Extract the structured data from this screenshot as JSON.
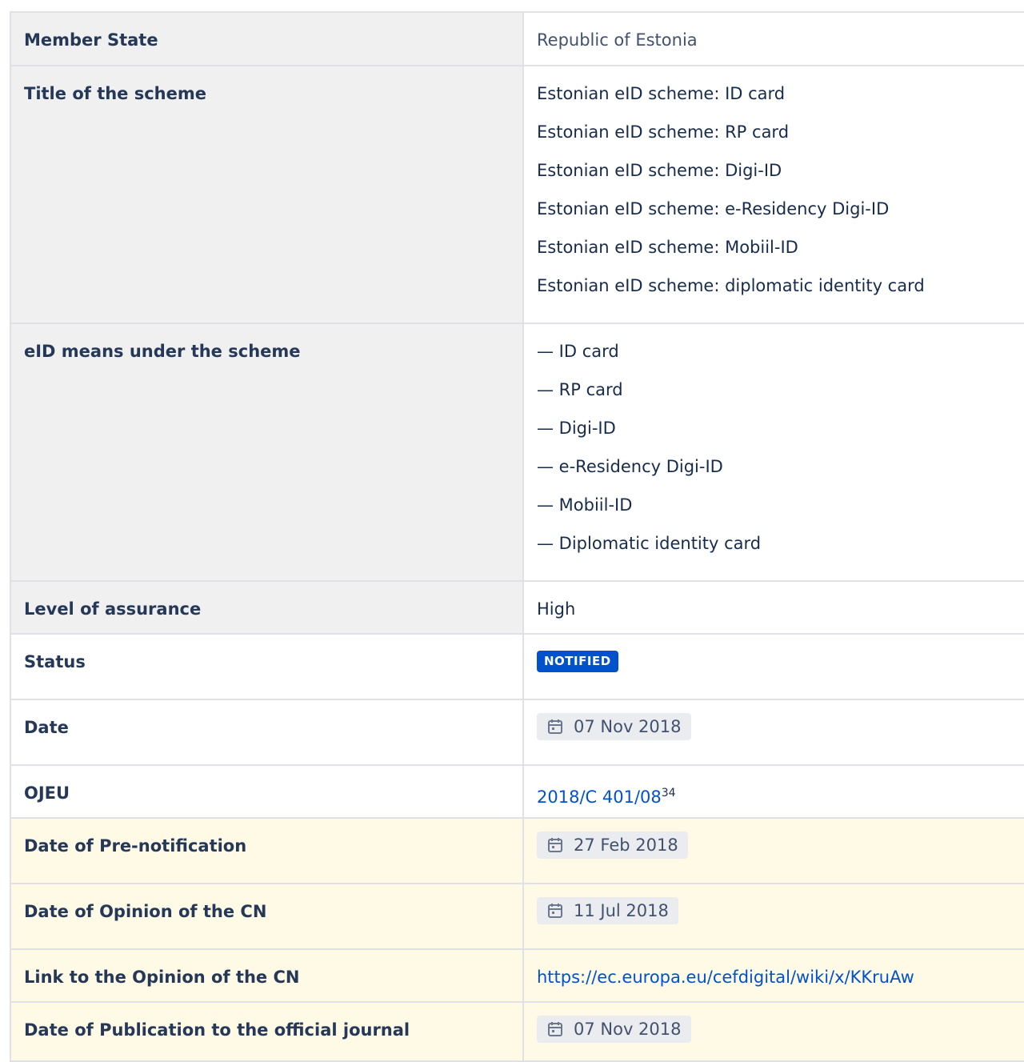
{
  "rows": {
    "member_state": {
      "label": "Member State",
      "value": "Republic of Estonia"
    },
    "title": {
      "label": "Title of the scheme",
      "values": [
        "Estonian eID scheme: ID card",
        "Estonian eID scheme: RP card",
        "Estonian eID scheme: Digi-ID",
        "Estonian eID scheme: e-Residency Digi-ID",
        "Estonian eID scheme: Mobiil-ID",
        "Estonian eID scheme: diplomatic identity card"
      ]
    },
    "means": {
      "label": "eID means under the scheme",
      "values": [
        "— ID card",
        "— RP card",
        "— Digi-ID",
        "— e-Residency Digi-ID",
        "— Mobiil-ID",
        "— Diplomatic identity card"
      ]
    },
    "level": {
      "label": "Level of assurance",
      "value": "High"
    },
    "status": {
      "label": "Status",
      "value": "NOTIFIED"
    },
    "date": {
      "label": "Date",
      "value": "07 Nov 2018"
    },
    "ojeu": {
      "label": "OJEU",
      "link_text": "2018/C 401/08",
      "footnote": "34"
    },
    "prenotification": {
      "label": "Date of Pre-notification",
      "value": "27 Feb 2018"
    },
    "opinion": {
      "label": "Date of Opinion of the CN",
      "value": "11 Jul 2018"
    },
    "opinion_link": {
      "label": "Link to the Opinion of the CN",
      "value": "https://ec.europa.eu/cefdigital/wiki/x/KKruAw"
    },
    "publication": {
      "label": "Date of Publication to the official journal",
      "value": "07 Nov 2018"
    }
  },
  "colors": {
    "badge": "#0052cc",
    "link": "#0052cc",
    "highlight_row": "#fffae6",
    "header_cell": "#f0f0f0"
  },
  "icons": {
    "date": "calendar-icon"
  }
}
